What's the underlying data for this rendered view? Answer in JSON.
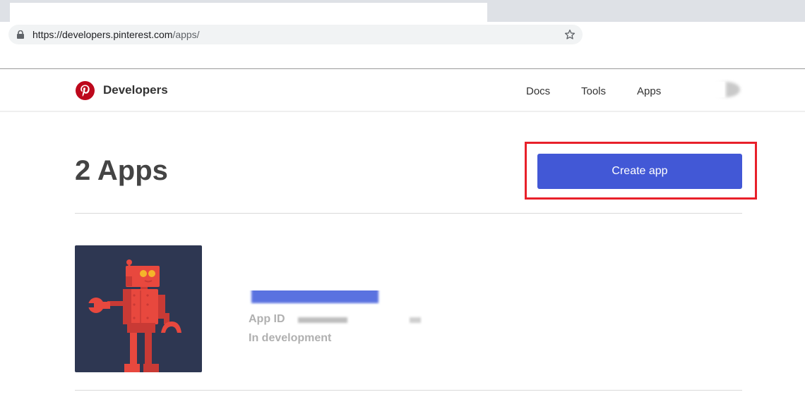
{
  "browser": {
    "url_host": "https://developers.pinterest.com",
    "url_path": "/apps/"
  },
  "header": {
    "brand": "Developers",
    "nav": {
      "docs": "Docs",
      "tools": "Tools",
      "apps": "Apps"
    }
  },
  "main": {
    "title": "2 Apps",
    "create_button_label": "Create app",
    "apps": [
      {
        "id_label": "App ID",
        "status": "In development"
      }
    ]
  },
  "colors": {
    "accent": "#4258d6",
    "highlight": "#e8202a",
    "pinterest_red": "#bd081c",
    "thumb_bg": "#2e3752"
  },
  "icons": {
    "lock": "lock-icon",
    "star": "star-icon",
    "logo": "pinterest-logo-icon"
  }
}
